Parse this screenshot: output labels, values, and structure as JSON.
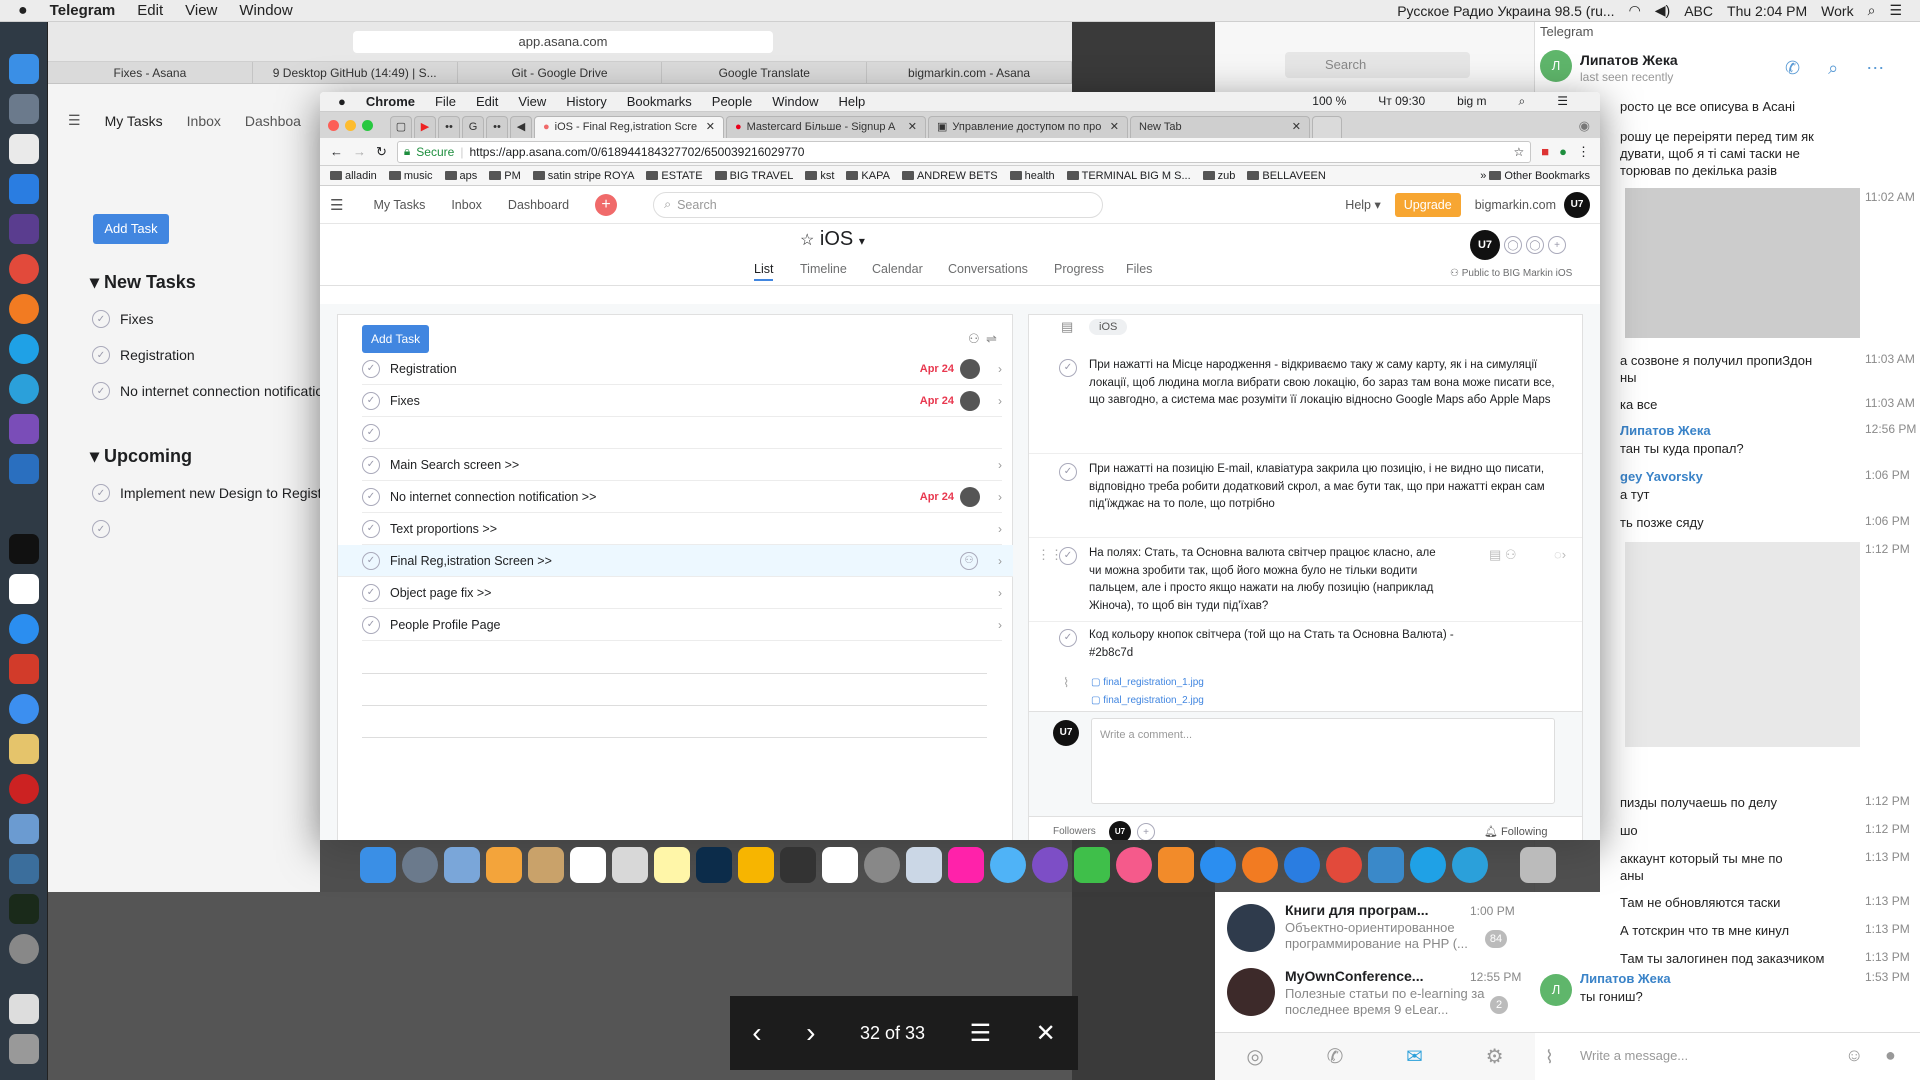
{
  "menubar": {
    "apple": "",
    "app": "Telegram",
    "items": [
      "Edit",
      "View",
      "Window"
    ],
    "radio": "Русское Радио Украина 98.5 (ru...",
    "abc": "ABC",
    "clock": "Thu 2:04 PM",
    "work": "Work"
  },
  "bgsafari": {
    "url": "app.asana.com",
    "tabs": [
      "Fixes - Asana",
      "9 Desktop GitHub (14:49) | S...",
      "Git - Google Drive",
      "Google Translate",
      "bigmarkin.com - Asana"
    ],
    "nav": [
      "My Tasks",
      "Inbox",
      "Dashboa"
    ],
    "add_task": "Add Task",
    "new_tasks": "New Tasks",
    "new_items": [
      "Fixes",
      "Registration",
      "No internet connection notificatio"
    ],
    "upcoming": "Upcoming",
    "upcoming_items": [
      "Implement new Design to Regist"
    ]
  },
  "telegram": {
    "title": "Telegram",
    "search": "Search",
    "contact": "Липатов Жека",
    "status": "last seen recently",
    "messages": [
      {
        "t": "росто це все описува в Асані",
        "time": ""
      },
      {
        "t": "рошу це переіряти перед тим як\nдувати, щоб я ті самі таски не\nторював по декілька разів",
        "time": "11:02 AM"
      },
      {
        "t": "а созвоне я получил пропиЗдон\nны",
        "time": "11:03 AM"
      },
      {
        "t": "ка все",
        "time": "11:03 AM"
      },
      {
        "t": "Липатов Жека",
        "time": "12:56 PM"
      },
      {
        "t": "тан ты куда пропал?",
        "time": ""
      },
      {
        "t": "gey Yavorsky",
        "time": "1:06 PM"
      },
      {
        "t": "а тут",
        "time": ""
      },
      {
        "t": "ть позже сяду",
        "time": "1:06 PM"
      },
      {
        "t": "",
        "time": "1:12 PM"
      },
      {
        "t": "пизды получаешь по делу",
        "time": "1:12 PM"
      },
      {
        "t": "шо",
        "time": "1:12 PM"
      },
      {
        "t": "аккаунт который ты мне по\nаны",
        "time": "1:13 PM"
      },
      {
        "t": "Там не обновляются таски",
        "time": "1:13 PM"
      },
      {
        "t": "А тотскрин что тв мне кинул",
        "time": "1:13 PM"
      },
      {
        "t": "Там ты залогинен под заказчиком",
        "time": "1:13 PM"
      },
      {
        "t": "Липатов Жека",
        "time": "1:53 PM"
      },
      {
        "t": "ты гониш?",
        "time": ""
      }
    ],
    "chats": [
      {
        "name": "Книги для програм...",
        "time": "1:00 PM",
        "preview": "Объектно-ориентированное программирование на PHP (...",
        "badge": "84"
      },
      {
        "name": "MyOwnConference...",
        "time": "12:55 PM",
        "preview": "Полезные статьи по e-learning за последнее время  9 eLear...",
        "badge": "2"
      }
    ],
    "composer": "Write a message..."
  },
  "chrome": {
    "menu": {
      "app": "Chrome",
      "items": [
        "File",
        "Edit",
        "View",
        "History",
        "Bookmarks",
        "People",
        "Window",
        "Help"
      ],
      "battery": "100 %",
      "clock": "Чт 09:30",
      "user": "big m"
    },
    "tabs": [
      "iOS - Final Reg,istration Scre",
      "Mastercard Більше - Signup A",
      "Управление доступом по про",
      "New Tab"
    ],
    "secure": "Secure",
    "url": "https://app.asana.com/0/618944184327702/650039216029770",
    "bookmarks": [
      "alladin",
      "music",
      "aps",
      "PM",
      "satin stripe ROYA",
      "ESTATE",
      "BIG TRAVEL",
      "kst",
      "KAPA",
      "ANDREW BETS",
      "health",
      "TERMINAL BIG M S...",
      "zub",
      "BELLAVEEN"
    ],
    "other_bookmarks": "Other Bookmarks"
  },
  "asana": {
    "nav": [
      "My Tasks",
      "Inbox",
      "Dashboard"
    ],
    "search": "Search",
    "help": "Help",
    "upgrade": "Upgrade",
    "workspace": "bigmarkin.com",
    "avatar": "U7",
    "project": "iOS",
    "project_tabs": [
      "List",
      "Timeline",
      "Calendar",
      "Conversations",
      "Progress",
      "Files"
    ],
    "public": "Public to BIG Markin iOS",
    "add_task": "Add Task",
    "tasks": [
      {
        "name": "Registration",
        "date": "Apr 24",
        "avatar": true
      },
      {
        "name": "Fixes",
        "date": "Apr 24",
        "avatar": true
      },
      {
        "name": "",
        "date": "",
        "avatar": false
      },
      {
        "name": "Main Search screen >>",
        "date": "",
        "avatar": false
      },
      {
        "name": "No internet connection notification >>",
        "date": "Apr 24",
        "avatar": true
      },
      {
        "name": "Text proportions >>",
        "date": "",
        "avatar": false
      },
      {
        "name": "Final Reg,istration Screen >>",
        "date": "",
        "avatar": false,
        "selected": true
      },
      {
        "name": "Object page fix >>",
        "date": "",
        "avatar": false
      },
      {
        "name": "People Profile Page",
        "date": "",
        "avatar": false
      }
    ],
    "detail": {
      "tag": "iOS",
      "subtasks": [
        "При нажатті на Місце народження - відкриваємо таку ж саму карту, як і на симуляції локації, щоб людина могла вибрати свою локацію, бо зараз там вона може писати все, що завгодно, а система має розуміти її локацію відносно Google Maps або Apple Maps",
        "При нажатті на позицію E-mail, клавіатура закрила цю позицію, і не видно що писати, відповідно треба робити додатковий скрол, а має бути так, що при нажатті екран сам під'їжджає на то поле, що потрібно",
        "На полях: Стать, та Основна валюта світчер працює класно, але чи можна зробити так, щоб його можна було не тільки водити пальцем, але і просто якщо нажати на любу позицію (наприклад Жіноча), то щоб він туди під'їхав?",
        "Код кольору кнопок світчера (той що на Стать та Основна Валюта) - #2b8c7d"
      ],
      "attachments": [
        "final_registration_1.jpg",
        "final_registration_2.jpg"
      ],
      "comment_placeholder": "Write a comment...",
      "followers": "Followers",
      "following": "Following"
    }
  },
  "viewer": {
    "counter": "32 of 33"
  },
  "colors": {
    "accent": "#4186e0",
    "upgrade": "#f7a632",
    "date": "#e8384f"
  }
}
